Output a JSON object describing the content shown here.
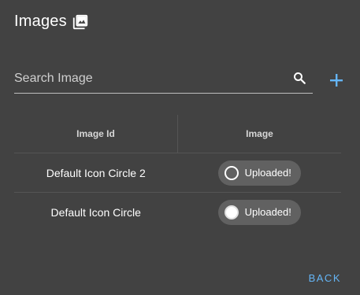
{
  "dialog": {
    "title": "Images",
    "title_icon": "photo-library-icon"
  },
  "search": {
    "placeholder": "Search Image",
    "value": "",
    "icon": "search-icon"
  },
  "add_button": {
    "icon": "plus-icon"
  },
  "table": {
    "headers": [
      "Image Id",
      "Image"
    ],
    "rows": [
      {
        "id": "Default Icon Circle 2",
        "status": "Uploaded!",
        "avatar": "hollow-circle"
      },
      {
        "id": "Default Icon Circle",
        "status": "Uploaded!",
        "avatar": "filled-circle"
      }
    ]
  },
  "actions": {
    "back_label": "BACK"
  },
  "colors": {
    "background": "#424242",
    "accent": "#64b5f6",
    "chip": "#616161"
  }
}
